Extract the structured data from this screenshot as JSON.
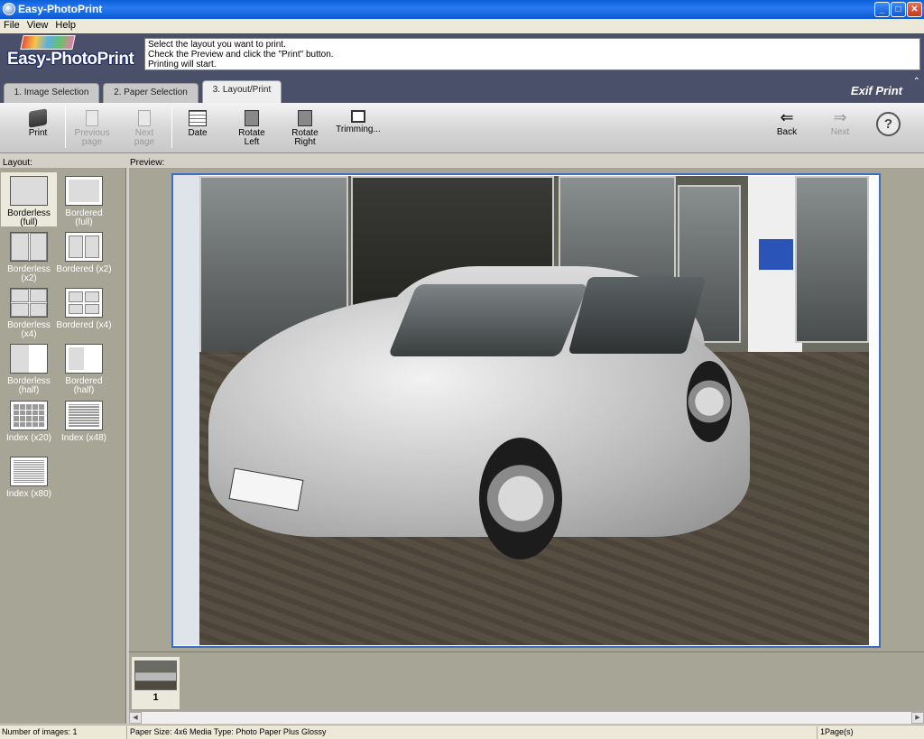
{
  "window": {
    "title": "Easy-PhotoPrint"
  },
  "menu": [
    "File",
    "View",
    "Help"
  ],
  "header": {
    "logo_text": "Easy-PhotoPrint",
    "instructions": [
      "Select the layout you want to print.",
      "Check the Preview and click the \"Print\" button.",
      "Printing will start."
    ]
  },
  "tabs": [
    {
      "label": "1. Image Selection"
    },
    {
      "label": "2. Paper Selection"
    },
    {
      "label": "3. Layout/Print",
      "active": true
    }
  ],
  "exif_logo": "Exif Print",
  "toolbar": {
    "print": "Print",
    "previous_page": [
      "Previous",
      "page"
    ],
    "next_page": [
      "Next",
      "page"
    ],
    "date": "Date",
    "rotate_left": [
      "Rotate",
      "Left"
    ],
    "rotate_right": [
      "Rotate",
      "Right"
    ],
    "trimming": "Trimming...",
    "back": "Back",
    "next": "Next",
    "help": "?"
  },
  "labels": {
    "layout": "Layout:",
    "preview": "Preview:"
  },
  "layouts": [
    {
      "label": [
        "Borderless",
        "(full)"
      ],
      "selected": true
    },
    {
      "label": [
        "Bordered (full)"
      ]
    },
    {
      "label": [
        "Borderless (x2)"
      ]
    },
    {
      "label": [
        "Bordered (x2)"
      ]
    },
    {
      "label": [
        "Borderless (x4)"
      ]
    },
    {
      "label": [
        "Bordered (x4)"
      ]
    },
    {
      "label": [
        "Borderless",
        "(half)"
      ]
    },
    {
      "label": [
        "Bordered (half)"
      ]
    },
    {
      "label": [
        "Index (x20)"
      ]
    },
    {
      "label": [
        "Index (x48)"
      ]
    },
    {
      "label": [
        "Index (x80)"
      ]
    }
  ],
  "thumbnails": [
    {
      "number": "1"
    }
  ],
  "status": {
    "images": "Number of images: 1",
    "paper": "Paper Size: 4x6  Media Type: Photo Paper Plus Glossy",
    "pages": "1Page(s)"
  },
  "colors": {
    "title_bar": "#0a5fd8",
    "header": "#4a4f6a",
    "panel": "#a7a596",
    "preview_border": "#3d6ec0"
  }
}
